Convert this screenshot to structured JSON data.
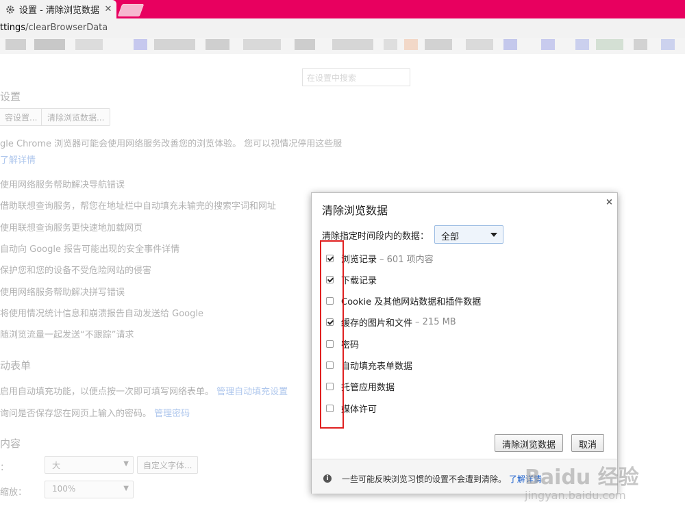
{
  "browser": {
    "tab_title": "设置 - 清除浏览数据",
    "tab_close": "✕",
    "url_prefix": "ttings",
    "url_path": "/clearBrowserData",
    "accent_color": "#e8005f"
  },
  "settings_page": {
    "search_placeholder": "在设置中搜索",
    "section1_heading": "设置",
    "btn_content_settings": "容设置...",
    "btn_clear_data": "清除浏览数据...",
    "privacy_desc": "gle Chrome 浏览器可能会使用网络服务改善您的浏览体验。 您可以视情况停用这些服",
    "learn_more": "了解详情",
    "privacy_items": [
      "使用网络服务帮助解决导航错误",
      "借助联想查询服务，帮您在地址栏中自动填充未输完的搜索字词和网址",
      "使用联想查询服务更快速地加载网页",
      "自动向 Google 报告可能出现的安全事件详情",
      "保护您和您的设备不受危险网站的侵害",
      "使用网络服务帮助解决拼写错误",
      "将使用情况统计信息和崩溃报告自动发送给 Google",
      "随浏览流量一起发送“不跟踪”请求"
    ],
    "section2_heading": "动表单",
    "autofill_text": "启用自动填充功能，以便点按一次即可填写网络表单。",
    "autofill_link": "管理自动填充设置",
    "password_text": "询问是否保存您在网页上输入的密码。",
    "password_link": "管理密码",
    "section3_heading": "内容",
    "font_label": "：",
    "font_size_value": "大",
    "btn_custom_fonts": "自定义字体...",
    "zoom_label": "缩放：",
    "zoom_value": "100%"
  },
  "dialog": {
    "title": "清除浏览数据",
    "close": "×",
    "time_range_label": "清除指定时间段内的数据：",
    "time_range_value": "全部",
    "options": [
      {
        "label": "浏览记录",
        "extra": "–  601 项内容",
        "checked": true
      },
      {
        "label": "下载记录",
        "extra": "",
        "checked": true
      },
      {
        "label": "Cookie 及其他网站数据和插件数据",
        "extra": "",
        "checked": false
      },
      {
        "label": "缓存的图片和文件",
        "extra": "–  215 MB",
        "checked": true
      },
      {
        "label": "密码",
        "extra": "",
        "checked": false
      },
      {
        "label": "自动填充表单数据",
        "extra": "",
        "checked": false
      },
      {
        "label": "托管应用数据",
        "extra": "",
        "checked": false
      },
      {
        "label": "媒体许可",
        "extra": "",
        "checked": false
      }
    ],
    "clear_button": "清除浏览数据",
    "cancel_button": "取消",
    "footer_text": "一些可能反映浏览习惯的设置不会遭到清除。",
    "footer_link": "了解详情",
    "info_icon": "i"
  },
  "watermark": {
    "main": "Baidu 经验",
    "sub": "jingyan.baidu.com"
  }
}
